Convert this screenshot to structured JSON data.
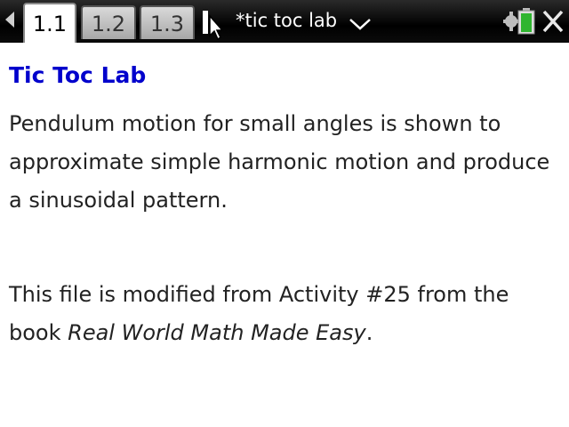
{
  "tabs": [
    {
      "label": "1.1",
      "active": true
    },
    {
      "label": "1.2",
      "active": false
    },
    {
      "label": "1.3",
      "active": false
    }
  ],
  "document": {
    "title": "*tic toc lab"
  },
  "icons": {
    "back": "left-arrow-icon",
    "cursor": "mouse-pointer-icon",
    "dropdown": "chevron-down-icon",
    "settings": "gear-icon",
    "battery": "battery-icon",
    "close": "close-icon"
  },
  "content": {
    "title": "Tic Toc Lab",
    "paragraph1": "Pendulum motion for small angles is shown to approximate simple harmonic motion and produce a sinusoidal pattern.",
    "paragraph2_prefix": "This file is modified from Activity #25 from the book ",
    "paragraph2_book": "Real World Math Made Easy",
    "paragraph2_suffix": "."
  },
  "colors": {
    "title": "#0000cc",
    "topbar": "#000000"
  }
}
